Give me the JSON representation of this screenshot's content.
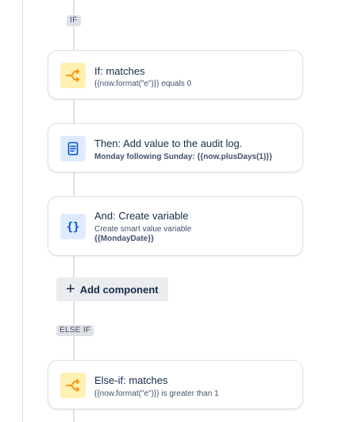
{
  "flow": {
    "if_tag": "IF",
    "else_if_tag": "ELSE IF",
    "add_component_label": "Add component",
    "steps": [
      {
        "kind": "condition",
        "icon": "branch-icon",
        "title": "If: matches",
        "subtitle": "{{now.format(\"e\")}} equals 0"
      },
      {
        "kind": "action",
        "icon": "document-icon",
        "title": "Then: Add value to the audit log.",
        "subtitle": "Monday following Sunday: {{now.plusDays(1)}}"
      },
      {
        "kind": "action",
        "icon": "braces-icon",
        "title": "And: Create variable",
        "subtitle": "Create smart value variable",
        "subtitle2": "{{MondayDate}}"
      },
      {
        "kind": "condition",
        "icon": "branch-icon",
        "title": "Else-if: matches",
        "subtitle": "{{now.format(\"e\")}} is greater than 1"
      }
    ]
  },
  "colors": {
    "condition_icon_bg": "#fff0b3",
    "condition_icon_fg": "#ff8b00",
    "action_icon_bg": "#deebff",
    "action_icon_fg": "#0052cc",
    "connector": "#dfe1e6"
  }
}
